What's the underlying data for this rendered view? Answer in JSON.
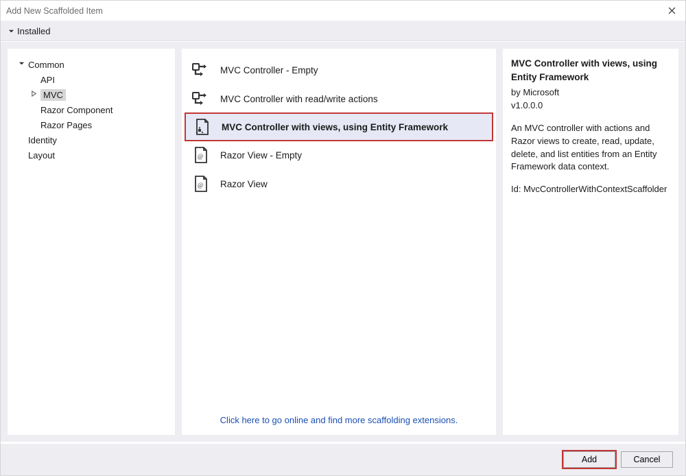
{
  "titlebar": {
    "title": "Add New Scaffolded Item"
  },
  "topstrip": {
    "label": "Installed"
  },
  "sidebar": {
    "items": {
      "common": "Common",
      "api": "API",
      "mvc": "MVC",
      "razor_component": "Razor Component",
      "razor_pages": "Razor Pages",
      "identity": "Identity",
      "layout": "Layout"
    }
  },
  "center": {
    "items": {
      "ctrl_empty": "MVC Controller - Empty",
      "ctrl_rw": "MVC Controller with read/write actions",
      "ctrl_ef": "MVC Controller with views, using Entity Framework",
      "view_empty": "Razor View - Empty",
      "view": "Razor View"
    },
    "footer_link": "Click here to go online and find more scaffolding extensions."
  },
  "details": {
    "title": "MVC Controller with views, using Entity Framework",
    "by": "by Microsoft",
    "version": "v1.0.0.0",
    "description": "An MVC controller with actions and Razor views to create, read, update, delete, and list entities from an Entity Framework data context.",
    "id": "Id: MvcControllerWithContextScaffolder"
  },
  "buttons": {
    "add": "Add",
    "cancel": "Cancel"
  }
}
